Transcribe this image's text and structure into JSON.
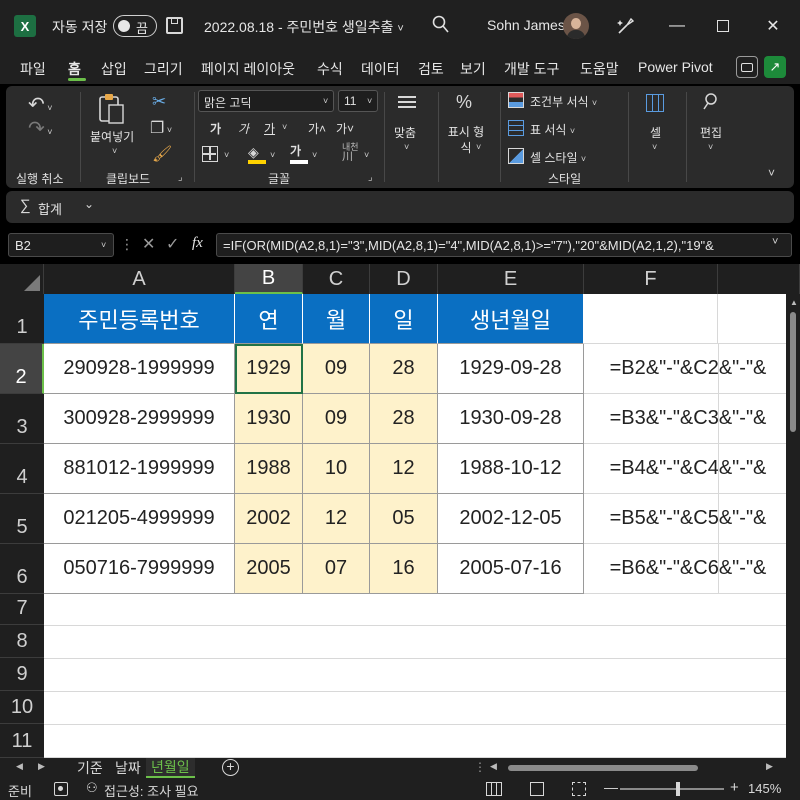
{
  "titlebar": {
    "app_icon": "X",
    "autosave_label": "자동 저장",
    "autosave_state": "끔",
    "filename": "2022.08.18 - 주민번호 생일추출",
    "user_name": "Sohn James"
  },
  "menu": {
    "items": [
      "파일",
      "홈",
      "삽입",
      "그리기",
      "페이지 레이아웃",
      "수식",
      "데이터",
      "검토",
      "보기",
      "개발 도구",
      "도움말",
      "Power Pivot"
    ],
    "active": "홈"
  },
  "ribbon": {
    "undo_label": "실행 취소",
    "paste_label": "붙여넣기",
    "clipboard_label": "클립보드",
    "font_name": "맑은 고딕",
    "font_size": "11",
    "font_group_label": "글꼴",
    "font_btns": [
      "가",
      "가",
      "가",
      "가˄",
      "가˅"
    ],
    "phonetic": "내천",
    "align_label": "맞춤",
    "number_label": "표시 형식",
    "cond_format": "조건부 서식",
    "table_format": "표 서식",
    "cell_style": "셀 스타일",
    "style_group_label": "스타일",
    "cells_label": "셀",
    "edit_label": "편집",
    "sum_label": "합계"
  },
  "formula_bar": {
    "name_box": "B2",
    "fx": "fx",
    "formula": "=IF(OR(MID(A2,8,1)=\"3\",MID(A2,8,1)=\"4\",MID(A2,8,1)>=\"7\"),\"20\"&MID(A2,1,2),\"19\"&"
  },
  "sheet": {
    "columns": [
      "A",
      "B",
      "C",
      "D",
      "E",
      "F"
    ],
    "rows": [
      "1",
      "2",
      "3",
      "4",
      "5",
      "6",
      "7",
      "8",
      "9",
      "10",
      "11"
    ],
    "headers": [
      "주민등록번호",
      "연",
      "월",
      "일",
      "생년월일"
    ],
    "data": [
      [
        "290928-1999999",
        "1929",
        "09",
        "28",
        "1929-09-28",
        "=B2&\"-\"&C2&\"-\"&"
      ],
      [
        "300928-2999999",
        "1930",
        "09",
        "28",
        "1930-09-28",
        "=B3&\"-\"&C3&\"-\"&"
      ],
      [
        "881012-1999999",
        "1988",
        "10",
        "12",
        "1988-10-12",
        "=B4&\"-\"&C4&\"-\"&"
      ],
      [
        "021205-4999999",
        "2002",
        "12",
        "05",
        "2002-12-05",
        "=B5&\"-\"&C5&\"-\"&"
      ],
      [
        "050716-7999999",
        "2005",
        "07",
        "16",
        "2005-07-16",
        "=B6&\"-\"&C6&\"-\"&"
      ]
    ],
    "selected_cell": "B2"
  },
  "tabs": {
    "items": [
      "기준",
      "날짜",
      "년월일"
    ],
    "active": "년월일",
    "add": "+"
  },
  "status": {
    "ready": "준비",
    "accessibility": "접근성: 조사 필요",
    "zoom": "145%"
  },
  "colors": {
    "header_fill": "#0a6fc2",
    "highlight_fill": "#fef2cb",
    "accent": "#6cc04a"
  }
}
